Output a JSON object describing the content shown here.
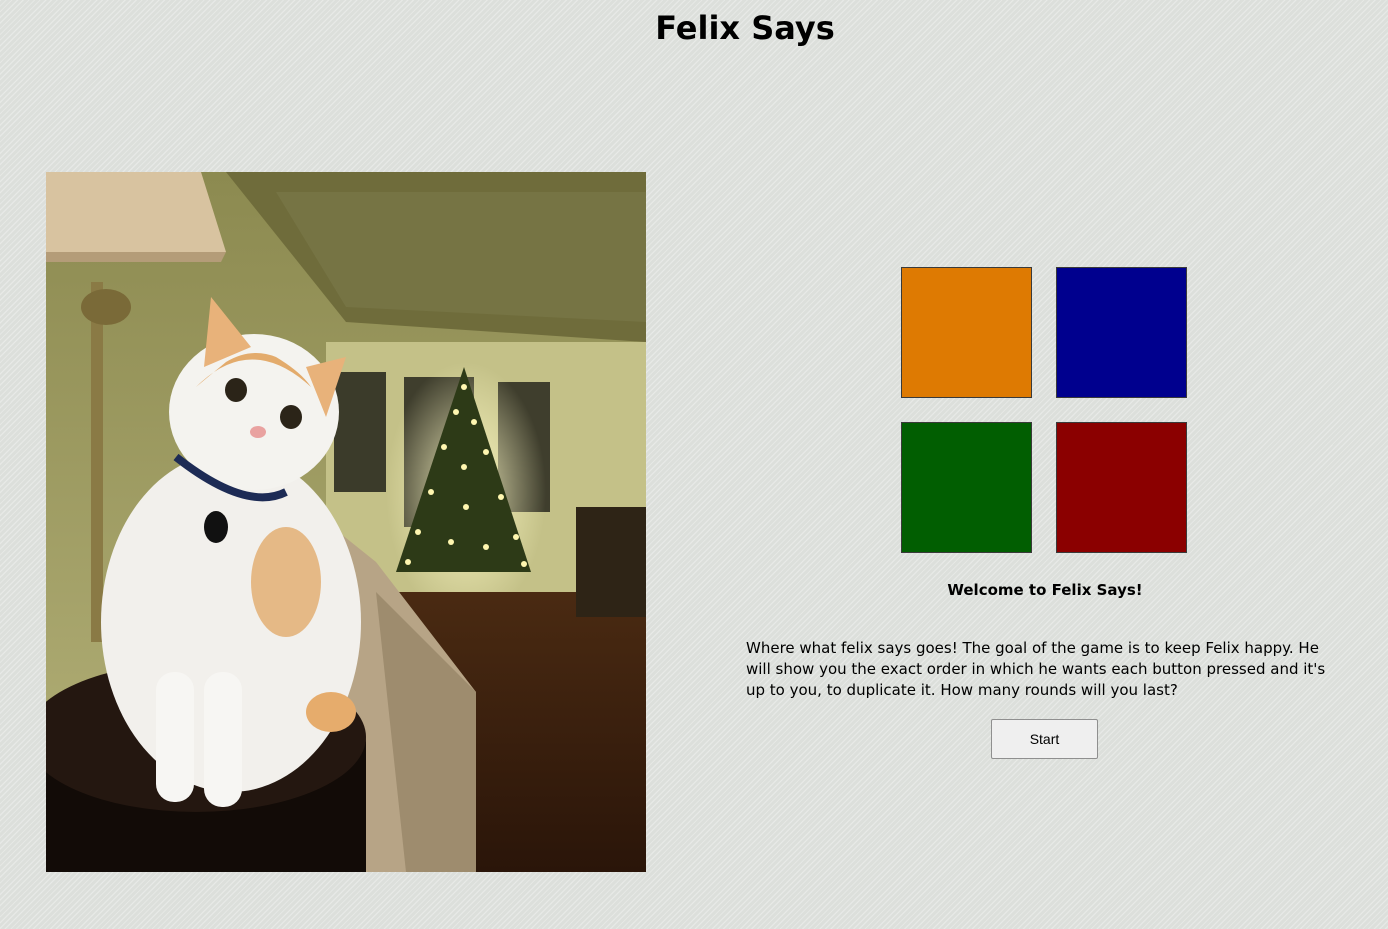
{
  "page": {
    "title": "Felix Says"
  },
  "photo": {
    "subject": "orange-and-white cat sitting on a side table beside a lamp, lit Christmas tree in background"
  },
  "game": {
    "pads": [
      {
        "name": "orange-pad",
        "color": "#de7a02"
      },
      {
        "name": "blue-pad",
        "color": "#00008e"
      },
      {
        "name": "green-pad",
        "color": "#015e01"
      },
      {
        "name": "red-pad",
        "color": "#8b0000"
      }
    ],
    "welcome": "Welcome to Felix Says!",
    "instructions": "Where what felix says goes! The goal of the game is to keep Felix happy. He will show you the exact order in which he wants each button pressed and it's up to you, to duplicate it. How many rounds will you last?",
    "start_label": "Start"
  }
}
